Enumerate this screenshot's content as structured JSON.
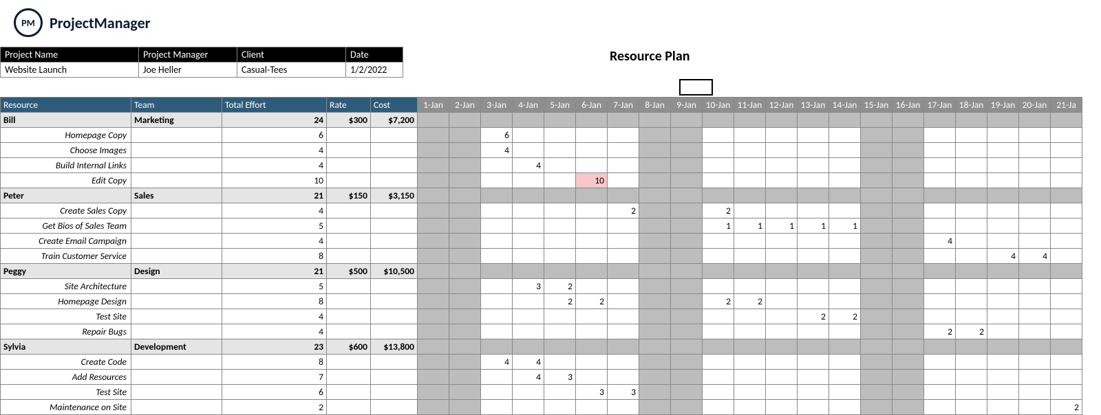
{
  "brand": {
    "badge": "PM",
    "name": "ProjectManager"
  },
  "info": {
    "headers": {
      "project_name": "Project Name",
      "project_manager": "Project Manager",
      "client": "Client",
      "date": "Date"
    },
    "values": {
      "project_name": "Website Launch",
      "project_manager": "Joe Heller",
      "client": "Casual-Tees",
      "date": "1/2/2022"
    }
  },
  "title": "Resource Plan",
  "columns": {
    "resource": "Resource",
    "team": "Team",
    "total_effort": "Total Effort",
    "rate": "Rate",
    "cost": "Cost"
  },
  "days": [
    "1-Jan",
    "2-Jan",
    "3-Jan",
    "4-Jan",
    "5-Jan",
    "6-Jan",
    "7-Jan",
    "8-Jan",
    "9-Jan",
    "10-Jan",
    "11-Jan",
    "12-Jan",
    "13-Jan",
    "14-Jan",
    "15-Jan",
    "16-Jan",
    "17-Jan",
    "18-Jan",
    "19-Jan",
    "20-Jan",
    "21-Ja"
  ],
  "weekend_idx": [
    0,
    1,
    7,
    8,
    14,
    15
  ],
  "groups": [
    {
      "name": "Bill",
      "team": "Marketing",
      "effort": "24",
      "rate": "$300",
      "cost": "$7,200",
      "tasks": [
        {
          "name": "Homepage Copy",
          "effort": "6",
          "cells": {
            "2": "6"
          }
        },
        {
          "name": "Choose Images",
          "effort": "4",
          "cells": {
            "2": "4"
          }
        },
        {
          "name": "Build Internal Links",
          "effort": "4",
          "cells": {
            "3": "4"
          }
        },
        {
          "name": "Edit Copy",
          "effort": "10",
          "cells": {
            "5": "10"
          },
          "highlight": [
            "5"
          ]
        }
      ]
    },
    {
      "name": "Peter",
      "team": "Sales",
      "effort": "21",
      "rate": "$150",
      "cost": "$3,150",
      "tasks": [
        {
          "name": "Create Sales Copy",
          "effort": "4",
          "cells": {
            "6": "2",
            "9": "2"
          }
        },
        {
          "name": "Get Bios of Sales Team",
          "effort": "5",
          "cells": {
            "9": "1",
            "10": "1",
            "11": "1",
            "12": "1",
            "13": "1"
          }
        },
        {
          "name": "Create Email Campaign",
          "effort": "4",
          "cells": {
            "16": "4"
          }
        },
        {
          "name": "Train Customer Service",
          "effort": "8",
          "cells": {
            "18": "4",
            "19": "4"
          }
        }
      ]
    },
    {
      "name": "Peggy",
      "team": "Design",
      "effort": "21",
      "rate": "$500",
      "cost": "$10,500",
      "tasks": [
        {
          "name": "Site Architecture",
          "effort": "5",
          "cells": {
            "3": "3",
            "4": "2"
          }
        },
        {
          "name": "Homepage Design",
          "effort": "8",
          "cells": {
            "4": "2",
            "5": "2",
            "9": "2",
            "10": "2"
          }
        },
        {
          "name": "Test Site",
          "effort": "4",
          "cells": {
            "12": "2",
            "13": "2"
          }
        },
        {
          "name": "Repair Bugs",
          "effort": "4",
          "cells": {
            "16": "2",
            "17": "2"
          }
        }
      ]
    },
    {
      "name": "Sylvia",
      "team": "Development",
      "effort": "23",
      "rate": "$600",
      "cost": "$13,800",
      "tasks": [
        {
          "name": "Create Code",
          "effort": "8",
          "cells": {
            "2": "4",
            "3": "4"
          }
        },
        {
          "name": "Add Resources",
          "effort": "7",
          "cells": {
            "3": "4",
            "4": "3"
          }
        },
        {
          "name": "Test Site",
          "effort": "6",
          "cells": {
            "5": "3",
            "6": "3"
          }
        },
        {
          "name": "Maintenance on Site",
          "effort": "2",
          "cells": {
            "20": "2"
          }
        }
      ]
    }
  ]
}
